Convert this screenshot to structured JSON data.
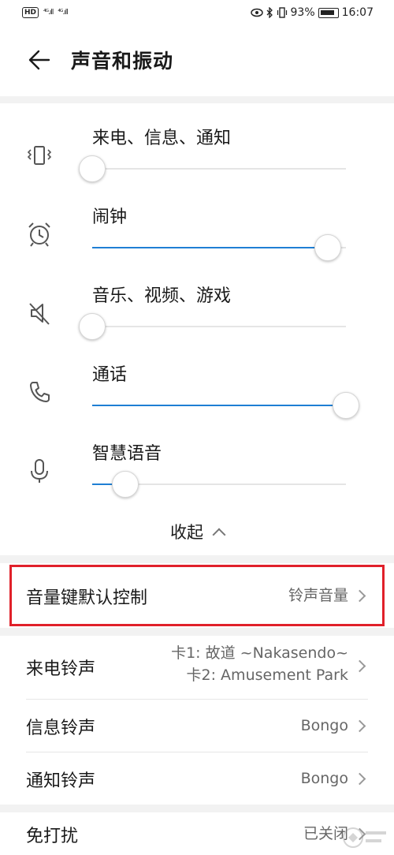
{
  "status_bar": {
    "hd": "HD",
    "sim1": "⁴ᴳ.ıll",
    "sim2": "⁴ᴳ.ıll",
    "battery": "93%",
    "time": "16:07"
  },
  "header": {
    "title": "声音和振动"
  },
  "volumes": [
    {
      "label": "来电、信息、通知",
      "icon": "ring-vibrate-icon",
      "level": 0.0
    },
    {
      "label": "闹钟",
      "icon": "alarm-clock-icon",
      "level": 0.93
    },
    {
      "label": "音乐、视频、游戏",
      "icon": "speaker-muted-icon",
      "level": 0.0
    },
    {
      "label": "通话",
      "icon": "phone-icon",
      "level": 1.0
    },
    {
      "label": "智慧语音",
      "icon": "microphone-icon",
      "level": 0.13
    }
  ],
  "collapse_label": "收起",
  "volume_key": {
    "label": "音量键默认控制",
    "value": "铃声音量"
  },
  "ringtones": {
    "call": {
      "label": "来电铃声",
      "value_line1": "卡1: 故道 ~Nakasendo~",
      "value_line2": "卡2: Amusement Park"
    },
    "message": {
      "label": "信息铃声",
      "value": "Bongo"
    },
    "notification": {
      "label": "通知铃声",
      "value": "Bongo"
    }
  },
  "dnd": {
    "label": "免打扰",
    "value": "已关闭"
  },
  "colors": {
    "accent": "#1f7fd4",
    "highlight": "#e0202a"
  }
}
